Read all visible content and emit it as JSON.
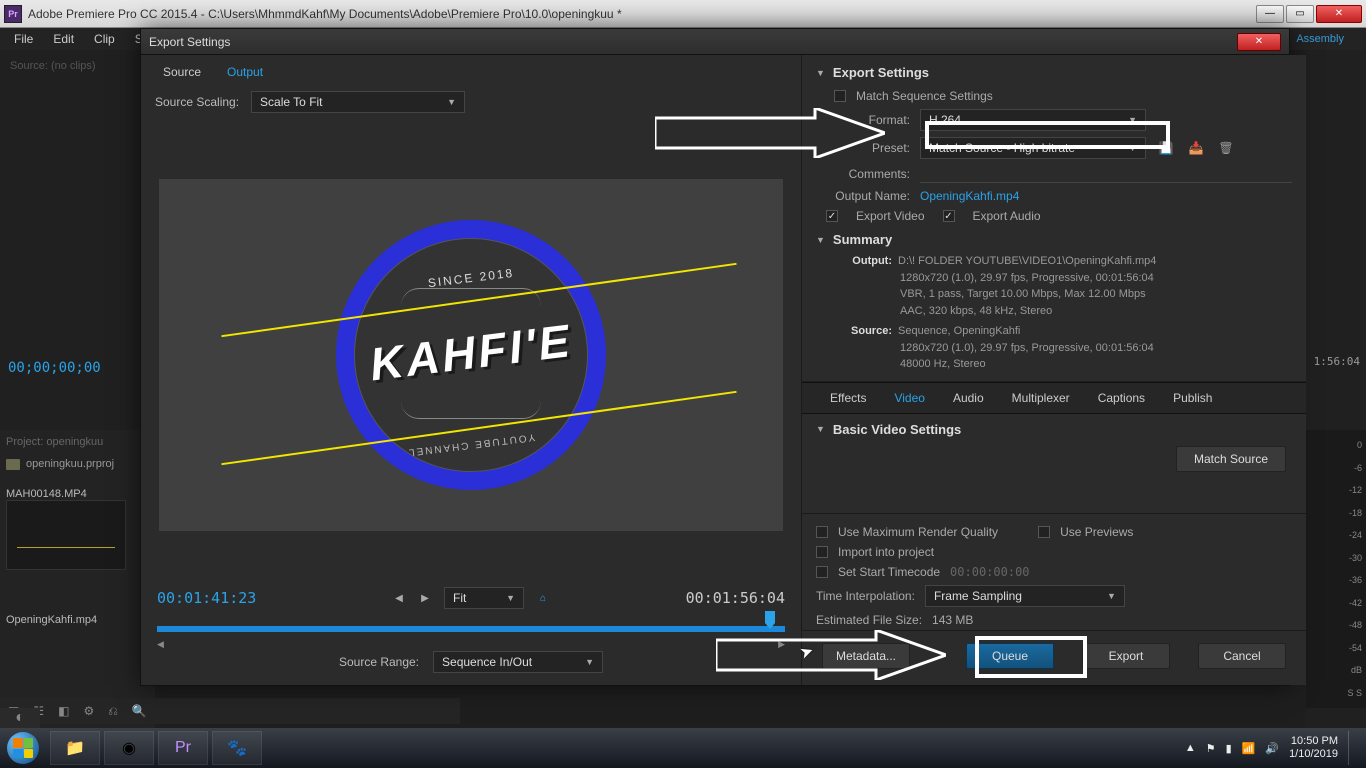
{
  "window": {
    "title": "Adobe Premiere Pro CC 2015.4 - C:\\Users\\MhmmdKahf\\My Documents\\Adobe\\Premiere Pro\\10.0\\openingkuu *",
    "app_short": "Pr"
  },
  "menubar": [
    "File",
    "Edit",
    "Clip",
    "Seque"
  ],
  "workspace": "Assembly",
  "host": {
    "source_label": "Source: (no clips)",
    "tc_left": "00;00;00;00",
    "tc_right": "1:56:04",
    "project_label": "Project: openingkuu",
    "project_file": "openingkuu.prproj",
    "clip1_name": "MAH00148.MP4",
    "clip2_name": "OpeningKahfi.mp4",
    "meter_scale": [
      "0",
      "-6",
      "-12",
      "-18",
      "-24",
      "-30",
      "-36",
      "-42",
      "-48",
      "-54",
      "dB"
    ],
    "meter_foot": "S  S"
  },
  "dialog": {
    "title": "Export Settings",
    "tabs": {
      "source": "Source",
      "output": "Output"
    },
    "source_scaling_label": "Source Scaling:",
    "source_scaling_value": "Scale To Fit",
    "preview": {
      "since": "SINCE 2018",
      "brand": "KAHFI'E",
      "yt": "YOUTUBE CHANNEL"
    },
    "timebar": {
      "tc_in": "00:01:41:23",
      "fit_label": "Fit",
      "tc_out": "00:01:56:04"
    },
    "source_range_label": "Source Range:",
    "source_range_value": "Sequence In/Out",
    "settings_header": "Export Settings",
    "match_seq_label": "Match Sequence Settings",
    "format_label": "Format:",
    "format_value": "H.264",
    "preset_label": "Preset:",
    "preset_value": "Match Source - High bitrate",
    "comments_label": "Comments:",
    "output_name_label": "Output Name:",
    "output_name_value": "OpeningKahfi.mp4",
    "export_video_label": "Export Video",
    "export_audio_label": "Export Audio",
    "summary_header": "Summary",
    "summary_output_label": "Output:",
    "summary_output_lines": [
      "D:\\! FOLDER YOUTUBE\\VIDEO1\\OpeningKahfi.mp4",
      "1280x720 (1.0), 29.97 fps, Progressive, 00:01:56:04",
      "VBR, 1 pass, Target 10.00 Mbps, Max 12.00 Mbps",
      "AAC, 320 kbps, 48 kHz, Stereo"
    ],
    "summary_source_label": "Source:",
    "summary_source_lines": [
      "Sequence, OpeningKahfi",
      "1280x720 (1.0), 29.97 fps, Progressive, 00:01:56:04",
      "48000 Hz, Stereo"
    ],
    "tabs2": [
      "Effects",
      "Video",
      "Audio",
      "Multiplexer",
      "Captions",
      "Publish"
    ],
    "tabs2_active_index": 1,
    "basic_video_header": "Basic Video Settings",
    "match_source_btn": "Match Source",
    "use_max_label": "Use Maximum Render Quality",
    "use_previews_label": "Use Previews",
    "import_project_label": "Import into project",
    "set_start_tc_label": "Set Start Timecode",
    "set_start_tc_value": "00:00:00:00",
    "time_interp_label": "Time Interpolation:",
    "time_interp_value": "Frame Sampling",
    "est_size_label": "Estimated File Size:",
    "est_size_value": "143 MB",
    "buttons": {
      "metadata": "Metadata...",
      "queue": "Queue",
      "export": "Export",
      "cancel": "Cancel"
    }
  },
  "taskbar": {
    "time": "10:50 PM",
    "date": "1/10/2019"
  }
}
